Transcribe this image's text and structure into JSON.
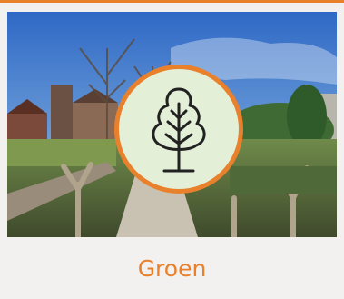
{
  "card": {
    "title": "Groen",
    "icon": "tree-icon"
  },
  "colors": {
    "accent": "#e9802c",
    "badge_bg": "#e3efd7",
    "card_bg": "#f2f1ef"
  }
}
